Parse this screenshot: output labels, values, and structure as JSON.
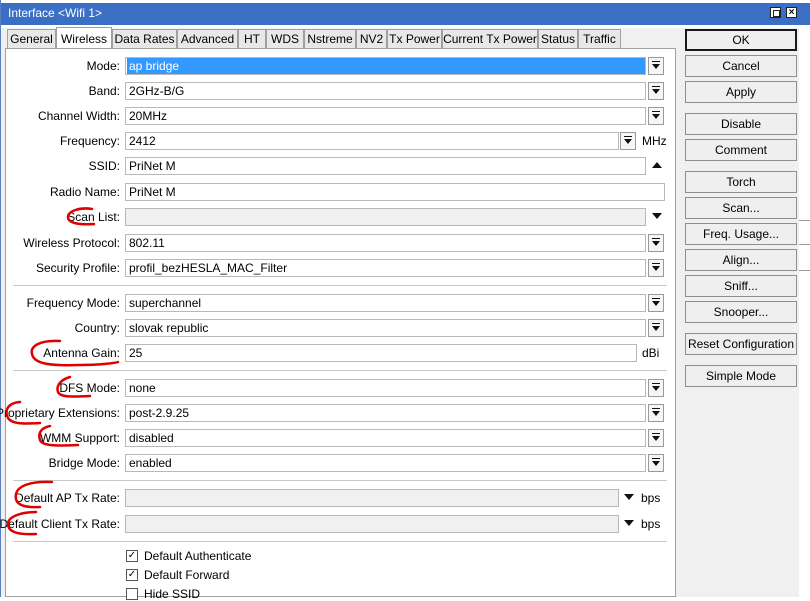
{
  "window": {
    "title": "Interface <Wifi 1>"
  },
  "tabs": [
    "General",
    "Wireless",
    "Data Rates",
    "Advanced",
    "HT",
    "WDS",
    "Nstreme",
    "NV2",
    "Tx Power",
    "Current Tx Power",
    "Status",
    "Traffic"
  ],
  "active_tab": "Wireless",
  "fields": {
    "mode": {
      "label": "Mode:",
      "value": "ap bridge"
    },
    "band": {
      "label": "Band:",
      "value": "2GHz-B/G"
    },
    "channel_width": {
      "label": "Channel Width:",
      "value": "20MHz"
    },
    "frequency": {
      "label": "Frequency:",
      "value": "2412",
      "unit": "MHz"
    },
    "ssid": {
      "label": "SSID:",
      "value": "PriNet M"
    },
    "radio_name": {
      "label": "Radio Name:",
      "value": "PriNet M"
    },
    "scan_list": {
      "label": "Scan List:",
      "value": ""
    },
    "wireless_protocol": {
      "label": "Wireless Protocol:",
      "value": "802.11"
    },
    "security_profile": {
      "label": "Security Profile:",
      "value": "profil_bezHESLA_MAC_Filter"
    },
    "frequency_mode": {
      "label": "Frequency Mode:",
      "value": "superchannel"
    },
    "country": {
      "label": "Country:",
      "value": "slovak republic"
    },
    "antenna_gain": {
      "label": "Antenna Gain:",
      "value": "25",
      "unit": "dBi"
    },
    "dfs_mode": {
      "label": "DFS Mode:",
      "value": "none"
    },
    "proprietary_extensions": {
      "label": "Proprietary Extensions:",
      "value": "post-2.9.25"
    },
    "wmm_support": {
      "label": "WMM Support:",
      "value": "disabled"
    },
    "bridge_mode": {
      "label": "Bridge Mode:",
      "value": "enabled"
    },
    "default_ap_tx_rate": {
      "label": "Default AP Tx Rate:",
      "value": "",
      "unit": "bps"
    },
    "default_client_tx_rate": {
      "label": "Default Client Tx Rate:",
      "value": "",
      "unit": "bps"
    }
  },
  "checkboxes": [
    {
      "label": "Default Authenticate",
      "checked": true
    },
    {
      "label": "Default Forward",
      "checked": true
    },
    {
      "label": "Hide SSID",
      "checked": false
    }
  ],
  "buttons": [
    "OK",
    "Cancel",
    "Apply",
    "Disable",
    "Comment",
    "Torch",
    "Scan...",
    "Freq. Usage...",
    "Align...",
    "Sniff...",
    "Snooper...",
    "Reset Configuration",
    "Simple Mode"
  ],
  "colors": {
    "titlebar": "#3b6fc4",
    "selection": "#3399ff",
    "annotation": "#e00000"
  }
}
